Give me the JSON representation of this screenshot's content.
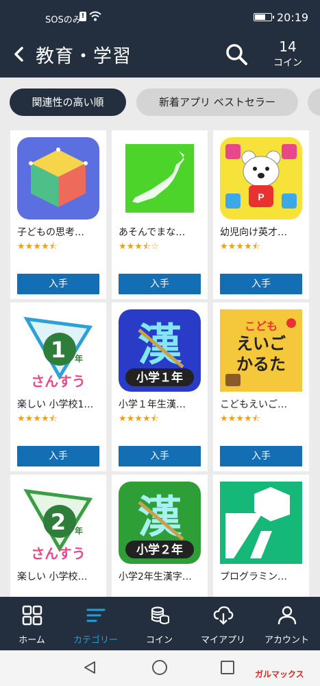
{
  "status_bar": {
    "carrier": "SOSのみ",
    "sim_icon": "sim-alert-icon",
    "time": "20:19"
  },
  "header": {
    "title": "教育・学習",
    "coin_count": "14",
    "coin_label": "コイン"
  },
  "filters": {
    "active": "関連性の高い順",
    "inactive": "新着アプリ ベストセラー"
  },
  "apps": [
    {
      "name": "子どもの思考…",
      "stars": "★★★★⯪",
      "rating": 4.5,
      "button": "入手",
      "icon": "cube-icon"
    },
    {
      "name": "あそんでまな…",
      "stars": "★★★⯪☆",
      "rating": 3.5,
      "button": "入手",
      "icon": "japan-map-icon"
    },
    {
      "name": "幼児向け英才…",
      "stars": "★★★★⯪",
      "rating": 4.5,
      "button": "入手",
      "icon": "bear-icon"
    },
    {
      "name": "楽しい 小学校1…",
      "stars": "★★★★⯪",
      "rating": 4.5,
      "button": "入手",
      "icon": "math-grade1-icon",
      "icon_text_top": "1",
      "icon_text_nen": "年",
      "icon_text_bottom": "さんすう"
    },
    {
      "name": "小学１年生漢…",
      "stars": "★★★★⯪",
      "rating": 4.5,
      "button": "入手",
      "icon": "kanji-grade1-icon",
      "icon_big": "漢",
      "icon_caption": "小学１年"
    },
    {
      "name": "こどもえいご…",
      "stars": "★★★★⯪",
      "rating": 4.5,
      "button": "入手",
      "icon": "english-karuta-icon",
      "icon_line1": "こども",
      "icon_line2": "えいご",
      "icon_line3": "かるた"
    },
    {
      "name": "楽しい 小学校…",
      "stars": "",
      "button": "",
      "icon": "math-grade2-icon",
      "icon_text_top": "2",
      "icon_text_nen": "年",
      "icon_text_bottom": "さんすう"
    },
    {
      "name": "小学2年生漢字…",
      "stars": "",
      "button": "",
      "icon": "kanji-grade2-icon",
      "icon_big": "漢",
      "icon_caption": "小学２年"
    },
    {
      "name": "プログラミン…",
      "stars": "",
      "button": "",
      "icon": "programming-icon"
    }
  ],
  "bottom_nav": [
    {
      "label": "ホーム",
      "icon": "grid-home-icon"
    },
    {
      "label": "カテゴリー",
      "icon": "category-lines-icon",
      "active": true
    },
    {
      "label": "コイン",
      "icon": "coins-icon"
    },
    {
      "label": "マイアプリ",
      "icon": "cloud-download-icon"
    },
    {
      "label": "アカウント",
      "icon": "person-icon"
    }
  ],
  "watermark": "ガルマックス",
  "colors": {
    "dark_navy": "#232f3e",
    "button_blue": "#146eb4",
    "active_tab": "#1aa0e6",
    "star": "#f0a010"
  }
}
